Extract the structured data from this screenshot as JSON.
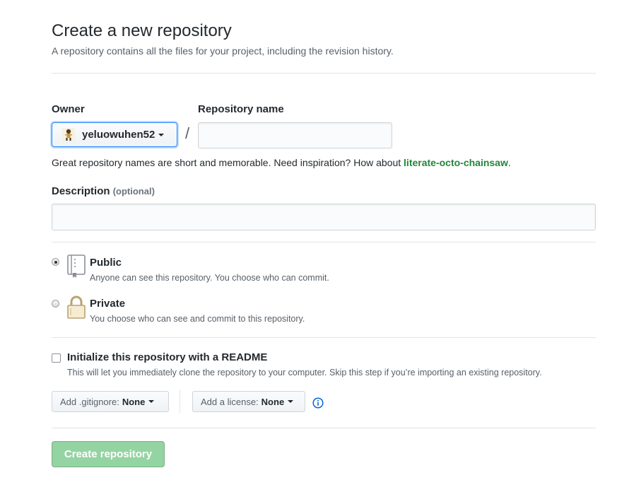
{
  "header": {
    "title": "Create a new repository",
    "subtitle": "A repository contains all the files for your project, including the revision history."
  },
  "owner": {
    "label": "Owner",
    "selected": "yeluowuhen52"
  },
  "repo_name": {
    "label": "Repository name",
    "value": "",
    "separator": "/"
  },
  "hint": {
    "text": "Great repository names are short and memorable. Need inspiration? How about ",
    "suggestion": "literate-octo-chainsaw",
    "end": "."
  },
  "description": {
    "label": "Description",
    "optional": "(optional)",
    "value": ""
  },
  "visibility": {
    "public": {
      "title": "Public",
      "desc": "Anyone can see this repository. You choose who can commit.",
      "checked": true
    },
    "private": {
      "title": "Private",
      "desc": "You choose who can see and commit to this repository.",
      "checked": false
    }
  },
  "readme": {
    "title": "Initialize this repository with a README",
    "desc": "This will let you immediately clone the repository to your computer. Skip this step if you’re importing an existing repository.",
    "checked": false
  },
  "gitignore": {
    "label": "Add .gitignore:",
    "value": "None"
  },
  "license": {
    "label": "Add a license:",
    "value": "None"
  },
  "submit": {
    "label": "Create repository"
  },
  "colors": {
    "accent": "#0366d6",
    "suggestion": "#22863a",
    "button_disabled": "#94d3a2",
    "info": "#0366d6"
  }
}
